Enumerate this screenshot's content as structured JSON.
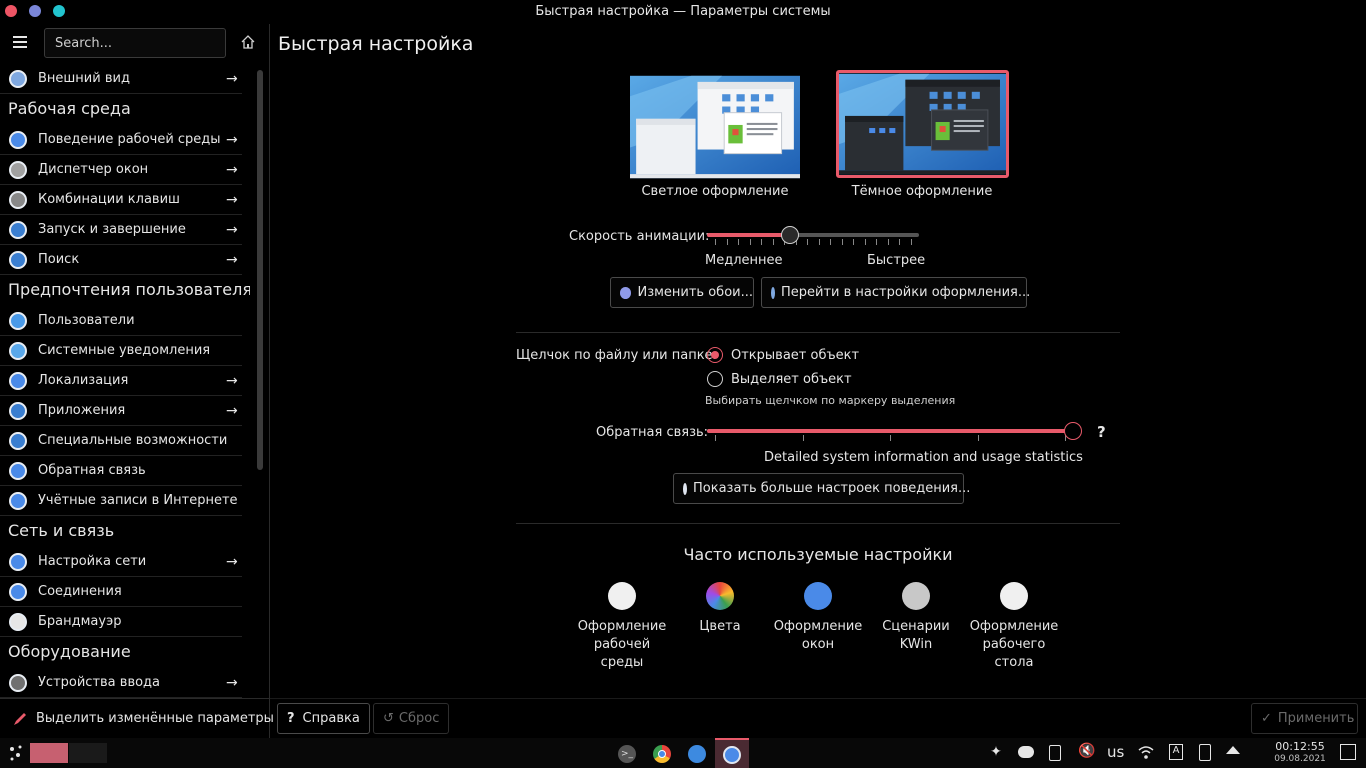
{
  "window": {
    "title": "Быстрая настройка — Параметры системы"
  },
  "sidebar": {
    "search_placeholder": "Search...",
    "items": [
      {
        "type": "item",
        "label": "Внешний вид",
        "arrow": true,
        "icon": "appearance-icon",
        "color": "#7fa8e0"
      },
      {
        "type": "category",
        "label": "Рабочая среда"
      },
      {
        "type": "item",
        "label": "Поведение рабочей среды",
        "arrow": true,
        "icon": "workspace-behavior-icon",
        "color": "#4a8ae8"
      },
      {
        "type": "item",
        "label": "Диспетчер окон",
        "arrow": true,
        "icon": "window-manager-icon",
        "color": "#a0a0a0"
      },
      {
        "type": "item",
        "label": "Комбинации клавиш",
        "arrow": true,
        "icon": "keyboard-icon",
        "color": "#888888"
      },
      {
        "type": "item",
        "label": "Запуск и завершение",
        "arrow": true,
        "icon": "startup-icon",
        "color": "#3a7ed0"
      },
      {
        "type": "item",
        "label": "Поиск",
        "arrow": true,
        "icon": "search-icon",
        "color": "#3a7ed0"
      },
      {
        "type": "category",
        "label": "Предпочтения пользователя"
      },
      {
        "type": "item",
        "label": "Пользователи",
        "arrow": false,
        "icon": "users-icon",
        "color": "#4a9ae8"
      },
      {
        "type": "item",
        "label": "Системные уведомления",
        "arrow": false,
        "icon": "notifications-icon",
        "color": "#5aa8ea"
      },
      {
        "type": "item",
        "label": "Локализация",
        "arrow": true,
        "icon": "localization-icon",
        "color": "#4a8ae8"
      },
      {
        "type": "item",
        "label": "Приложения",
        "arrow": true,
        "icon": "applications-icon",
        "color": "#3a7ed0"
      },
      {
        "type": "item",
        "label": "Специальные возможности",
        "arrow": false,
        "icon": "accessibility-icon",
        "color": "#3a7ed0"
      },
      {
        "type": "item",
        "label": "Обратная связь",
        "arrow": false,
        "icon": "feedback-icon",
        "color": "#4a8ae8"
      },
      {
        "type": "item",
        "label": "Учётные записи в Интернете",
        "arrow": false,
        "icon": "online-accounts-icon",
        "color": "#4a8ae8"
      },
      {
        "type": "category",
        "label": "Сеть и связь"
      },
      {
        "type": "item",
        "label": "Настройка сети",
        "arrow": true,
        "icon": "network-icon",
        "color": "#4a8ae8"
      },
      {
        "type": "item",
        "label": "Соединения",
        "arrow": false,
        "icon": "connections-icon",
        "color": "#4a8ae8"
      },
      {
        "type": "item",
        "label": "Брандмауэр",
        "arrow": false,
        "icon": "firewall-icon",
        "color": "#e6e6e6"
      },
      {
        "type": "category",
        "label": "Оборудование"
      },
      {
        "type": "item",
        "label": "Устройства ввода",
        "arrow": true,
        "icon": "input-devices-icon",
        "color": "#707070"
      }
    ],
    "footer_label": "Выделить изменённые параметры"
  },
  "main": {
    "title": "Быстрая настройка",
    "themes": {
      "light_label": "Светлое оформление",
      "dark_label": "Тёмное оформление",
      "selected": "dark"
    },
    "animation": {
      "label": "Скорость анимации:",
      "slow": "Медленнее",
      "fast": "Быстрее",
      "value_fraction": 0.39
    },
    "buttons": {
      "wallpaper": "Изменить обои...",
      "appearance": "Перейти в настройки оформления..."
    },
    "click": {
      "label": "Щелчок по файлу или папке:",
      "option_open": "Открывает объект",
      "option_select": "Выделяет объект",
      "hint": "Выбирать щелчком по маркеру выделения",
      "selected": "open"
    },
    "feedback": {
      "label": "Обратная связь:",
      "description": "Detailed system information and usage statistics",
      "value_fraction": 1.0,
      "help": "?"
    },
    "more_behavior": "Показать больше настроек поведения...",
    "frequent": {
      "title": "Часто используемые настройки",
      "items": [
        {
          "label": "Оформление рабочей среды",
          "icon": "desktop-theme-icon"
        },
        {
          "label": "Цвета",
          "icon": "colors-icon"
        },
        {
          "label": "Оформление окон",
          "icon": "window-decorations-icon"
        },
        {
          "label": "Сценарии KWin",
          "icon": "kwin-scripts-icon"
        },
        {
          "label": "Оформление рабочего стола",
          "icon": "workspace-theme-icon"
        }
      ]
    },
    "footer": {
      "help": "Справка",
      "reset": "Сброс",
      "apply": "Применить"
    }
  },
  "taskbar": {
    "keyboard_layout": "us",
    "time": "00:12:55",
    "date": "09.08.2021"
  },
  "colors": {
    "accent": "#e85a6a",
    "background": "#000000"
  }
}
